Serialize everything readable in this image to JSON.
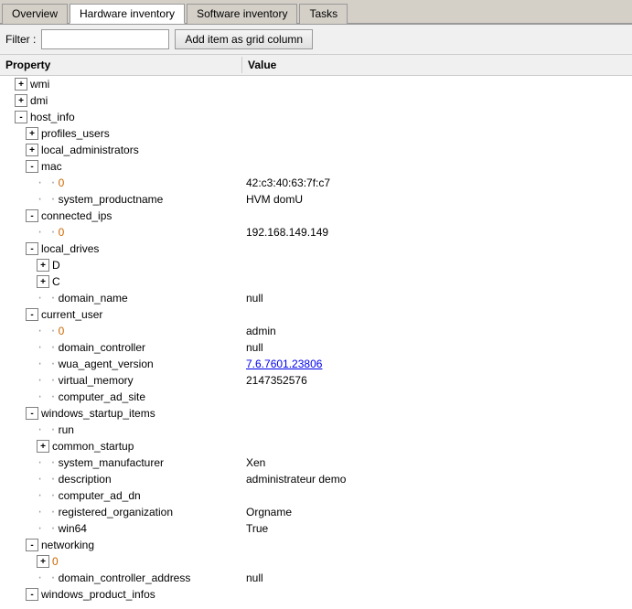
{
  "tabs": [
    {
      "label": "Overview",
      "active": false
    },
    {
      "label": "Hardware inventory",
      "active": true
    },
    {
      "label": "Software inventory",
      "active": false
    },
    {
      "label": "Tasks",
      "active": false
    }
  ],
  "filter": {
    "label": "Filter :",
    "placeholder": "",
    "add_button": "Add item as grid column"
  },
  "table": {
    "col_property": "Property",
    "col_value": "Value"
  },
  "rows": [
    {
      "indent": 1,
      "expander": "+",
      "key": "wmi",
      "value": "",
      "key_color": "normal"
    },
    {
      "indent": 1,
      "expander": "+",
      "key": "dmi",
      "value": "",
      "key_color": "normal"
    },
    {
      "indent": 1,
      "expander": "-",
      "key": "host_info",
      "value": "",
      "key_color": "normal"
    },
    {
      "indent": 2,
      "expander": "+",
      "key": "profiles_users",
      "value": "",
      "key_color": "normal"
    },
    {
      "indent": 2,
      "expander": "+",
      "key": "local_administrators",
      "value": "",
      "key_color": "normal"
    },
    {
      "indent": 2,
      "expander": "-",
      "key": "mac",
      "value": "",
      "key_color": "normal"
    },
    {
      "indent": 3,
      "expander": null,
      "key": "0",
      "value": "42:c3:40:63:7f:c7",
      "key_color": "orange"
    },
    {
      "indent": 3,
      "expander": null,
      "key": "system_productname",
      "value": "HVM domU",
      "key_color": "normal"
    },
    {
      "indent": 2,
      "expander": "-",
      "key": "connected_ips",
      "value": "",
      "key_color": "normal"
    },
    {
      "indent": 3,
      "expander": null,
      "key": "0",
      "value": "192.168.149.149",
      "key_color": "orange"
    },
    {
      "indent": 2,
      "expander": "-",
      "key": "local_drives",
      "value": "",
      "key_color": "normal"
    },
    {
      "indent": 3,
      "expander": "+",
      "key": "D",
      "value": "",
      "key_color": "normal"
    },
    {
      "indent": 3,
      "expander": "+",
      "key": "C",
      "value": "",
      "key_color": "normal"
    },
    {
      "indent": 3,
      "expander": null,
      "key": "domain_name",
      "value": "null",
      "key_color": "normal"
    },
    {
      "indent": 2,
      "expander": "-",
      "key": "current_user",
      "value": "",
      "key_color": "normal"
    },
    {
      "indent": 3,
      "expander": null,
      "key": "0",
      "value": "admin",
      "key_color": "orange"
    },
    {
      "indent": 3,
      "expander": null,
      "key": "domain_controller",
      "value": "null",
      "key_color": "normal"
    },
    {
      "indent": 3,
      "expander": null,
      "key": "wua_agent_version",
      "value": "7.6.7601.23806",
      "key_color": "normal",
      "value_color": "link"
    },
    {
      "indent": 3,
      "expander": null,
      "key": "virtual_memory",
      "value": "2147352576",
      "key_color": "normal"
    },
    {
      "indent": 3,
      "expander": null,
      "key": "computer_ad_site",
      "value": "",
      "key_color": "normal"
    },
    {
      "indent": 2,
      "expander": "-",
      "key": "windows_startup_items",
      "value": "",
      "key_color": "normal"
    },
    {
      "indent": 3,
      "expander": null,
      "key": "run",
      "value": "",
      "key_color": "normal"
    },
    {
      "indent": 3,
      "expander": "+",
      "key": "common_startup",
      "value": "",
      "key_color": "normal"
    },
    {
      "indent": 3,
      "expander": null,
      "key": "system_manufacturer",
      "value": "Xen",
      "key_color": "normal"
    },
    {
      "indent": 3,
      "expander": null,
      "key": "description",
      "value": "administrateur demo",
      "key_color": "normal"
    },
    {
      "indent": 3,
      "expander": null,
      "key": "computer_ad_dn",
      "value": "",
      "key_color": "normal"
    },
    {
      "indent": 3,
      "expander": null,
      "key": "registered_organization",
      "value": "Orgname",
      "key_color": "normal"
    },
    {
      "indent": 3,
      "expander": null,
      "key": "win64",
      "value": "True",
      "key_color": "normal"
    },
    {
      "indent": 2,
      "expander": "-",
      "key": "networking",
      "value": "",
      "key_color": "normal"
    },
    {
      "indent": 3,
      "expander": "+",
      "key": "0",
      "value": "",
      "key_color": "orange"
    },
    {
      "indent": 3,
      "expander": null,
      "key": "domain_controller_address",
      "value": "null",
      "key_color": "normal"
    },
    {
      "indent": 2,
      "expander": "-",
      "key": "windows_product_infos",
      "value": "",
      "key_color": "normal"
    }
  ]
}
